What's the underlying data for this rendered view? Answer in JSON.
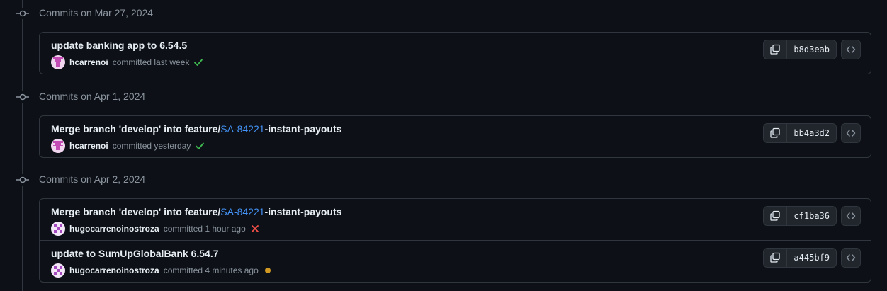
{
  "colors": {
    "background": "#0d1117",
    "border": "#30363d",
    "muted": "#8b949e",
    "link": "#4493f8",
    "success": "#3fb950",
    "failure": "#f85149",
    "pending": "#d29922"
  },
  "groups": [
    {
      "title": "Commits on Mar 27, 2024",
      "commits": [
        {
          "message_pre": "update banking app to 6.54.5",
          "message_link": "",
          "message_post": "",
          "author": "hcarrenoi",
          "time": "committed last week",
          "status": "success-check-icon",
          "sha": "b8d3eab"
        }
      ]
    },
    {
      "title": "Commits on Apr 1, 2024",
      "commits": [
        {
          "message_pre": "Merge branch 'develop' into feature/",
          "message_link": "SA-84221",
          "message_post": "-instant-payouts",
          "author": "hcarrenoi",
          "time": "committed yesterday",
          "status": "success-check-icon",
          "sha": "bb4a3d2"
        }
      ]
    },
    {
      "title": "Commits on Apr 2, 2024",
      "commits": [
        {
          "message_pre": "Merge branch 'develop' into feature/",
          "message_link": "SA-84221",
          "message_post": "-instant-payouts",
          "author": "hugocarrenoinostroza",
          "time": "committed 1 hour ago",
          "status": "failure-x-icon",
          "sha": "cf1ba36"
        },
        {
          "message_pre": "update to SumUpGlobalBank 6.54.7",
          "message_link": "",
          "message_post": "",
          "author": "hugocarrenoinostroza",
          "time": "committed 4 minutes ago",
          "status": "pending-dot-icon",
          "sha": "a445bf9"
        }
      ]
    }
  ]
}
